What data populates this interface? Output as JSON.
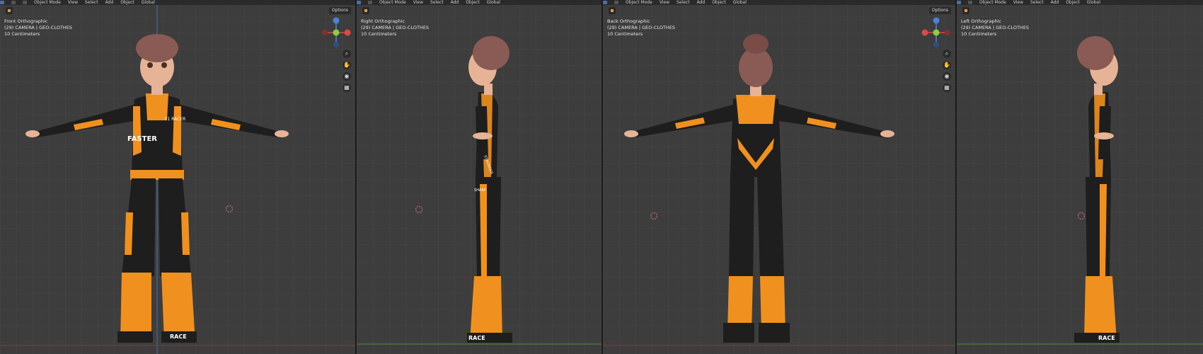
{
  "header": {
    "mode": "Object Mode",
    "menus": [
      "View",
      "Select",
      "Add",
      "Object"
    ],
    "transform": "Global",
    "options_label": "Options"
  },
  "viewports": [
    {
      "view_name": "Front Orthographic",
      "collection": "(29) CAMERA | GEO-CLOTHES",
      "scale": "10 Centimeters",
      "view": "front"
    },
    {
      "view_name": "Right Orthographic",
      "collection": "(29) CAMERA | GEO-CLOTHES",
      "scale": "10 Centimeters",
      "view": "right"
    },
    {
      "view_name": "Back Orthographic",
      "collection": "(29) CAMERA | GEO-CLOTHES",
      "scale": "10 Centimeters",
      "view": "back"
    },
    {
      "view_name": "Left Orthographic",
      "collection": "(29) CAMERA | GEO-CLOTHES",
      "scale": "10 Centimeters",
      "view": "left"
    }
  ],
  "suit_text": {
    "chest": "F1 RACER",
    "front_body": "FASTER",
    "boot": "RACE",
    "side_arm": "STRONGER",
    "side_hip": "SHARP"
  },
  "colors": {
    "viewport_bg": "#3d3d3d",
    "suit_black": "#1e1e1e",
    "suit_orange": "#f0901e",
    "hair": "#8a5a55",
    "skin": "#e7b396"
  }
}
